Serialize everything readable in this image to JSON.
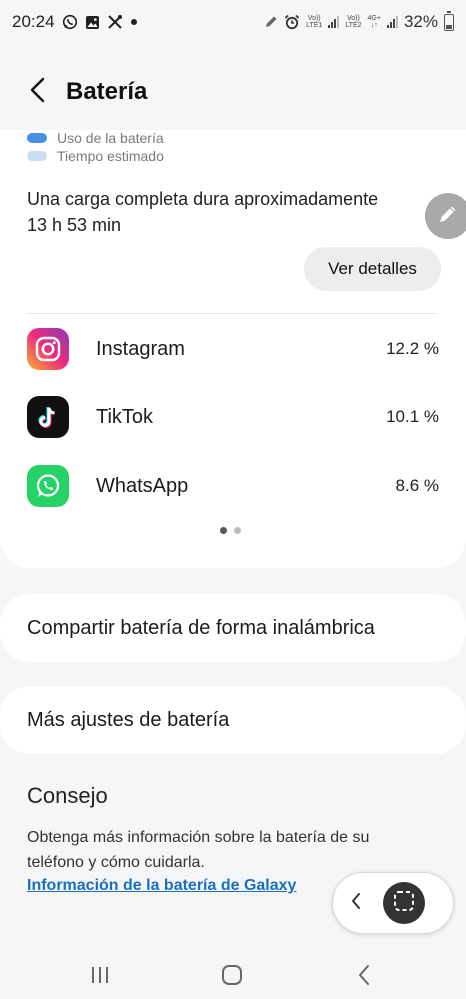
{
  "status_bar": {
    "time": "20:24",
    "notification_icons": [
      "whatsapp-icon",
      "gallery-icon",
      "tools-icon",
      "dot-icon"
    ],
    "sim1_label_top": "Vo))",
    "sim1_label_bottom": "LTE1",
    "sim2_label_top": "Vo))",
    "sim2_label_bottom": "LTE2",
    "network_type": "4G+",
    "battery_percent": "32%"
  },
  "header": {
    "title": "Batería"
  },
  "usage": {
    "legend": [
      {
        "label": "Uso de la batería",
        "color": "#4a90e2"
      },
      {
        "label": "Tiempo estimado",
        "color": "#c9def5"
      }
    ],
    "estimate_line1": "Una carga completa dura aproximadamente",
    "estimate_line2": "13 h 53 min",
    "details_button": "Ver detalles",
    "apps": [
      {
        "name": "Instagram",
        "percent": "12.2 %",
        "icon": "instagram-icon"
      },
      {
        "name": "TikTok",
        "percent": "10.1 %",
        "icon": "tiktok-icon"
      },
      {
        "name": "WhatsApp",
        "percent": "8.6 %",
        "icon": "whatsapp-icon"
      }
    ],
    "page_indicator": {
      "pages": 2,
      "active": 1
    }
  },
  "settings": {
    "wireless_share": "Compartir batería de forma inalámbrica",
    "more_settings": "Más ajustes de batería"
  },
  "tip": {
    "title": "Consejo",
    "body": "Obtenga más información sobre la batería de su teléfono y cómo cuidarla.",
    "link": "Información de la batería de Galaxy"
  },
  "floating_controls": {
    "icons": [
      "chevron-left-icon",
      "screenshot-icon"
    ]
  },
  "nav_bar": {
    "icons": [
      "recents-icon",
      "home-icon",
      "back-icon"
    ]
  },
  "colors": {
    "accent": "#1a6fbd",
    "fab": "#a8a8a8"
  }
}
